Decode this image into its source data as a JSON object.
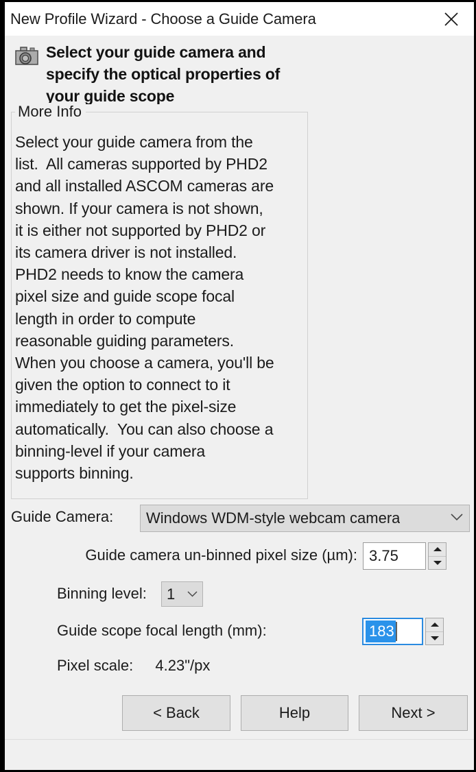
{
  "window": {
    "title": "New Profile Wizard - Choose a Guide Camera",
    "close_icon": "close-icon"
  },
  "header": {
    "icon": "camera-icon",
    "line1": "Select your guide camera and",
    "line2": "specify the optical properties of",
    "line3": "your guide scope"
  },
  "more_info": {
    "legend": "More Info",
    "lines": [
      "Select your guide camera from the",
      "list.  All cameras supported by PHD2",
      "and all installed ASCOM cameras are",
      "shown. If your camera is not shown,",
      "it is either not supported by PHD2 or",
      "its camera driver is not installed.",
      "PHD2 needs to know the camera",
      "pixel size and guide scope focal",
      "length in order to compute",
      "reasonable guiding parameters.",
      "When you choose a camera, you'll be",
      "given the option to connect to it",
      "immediately to get the pixel-size",
      "automatically.  You can also choose a",
      "binning-level if your camera",
      "supports binning."
    ]
  },
  "form": {
    "guide_camera_label": "Guide Camera:",
    "guide_camera_value": "Windows WDM-style webcam camera",
    "guide_camera_chevron": "chevron-down-icon",
    "pixel_size_label": "Guide camera un-binned pixel size (µm):",
    "pixel_size_value": "3.75",
    "binning_label": "Binning level:",
    "binning_value": "1",
    "binning_chevron": "chevron-down-icon",
    "focal_length_label": "Guide scope focal length (mm):",
    "focal_length_value": "183",
    "pixel_scale_label": "Pixel scale:",
    "pixel_scale_value": "4.23\"/px"
  },
  "buttons": {
    "back": "< Back",
    "help": "Help",
    "next": "Next >"
  },
  "colors": {
    "dialog_background": "#f0f0f0",
    "titlebar_background": "#ffffff",
    "selection_blue": "#2a92ea",
    "focus_border": "#2a8ae0",
    "control_gray": "#dcdcdc",
    "button_gray": "#e1e1e1",
    "text": "#1b1b1b"
  }
}
